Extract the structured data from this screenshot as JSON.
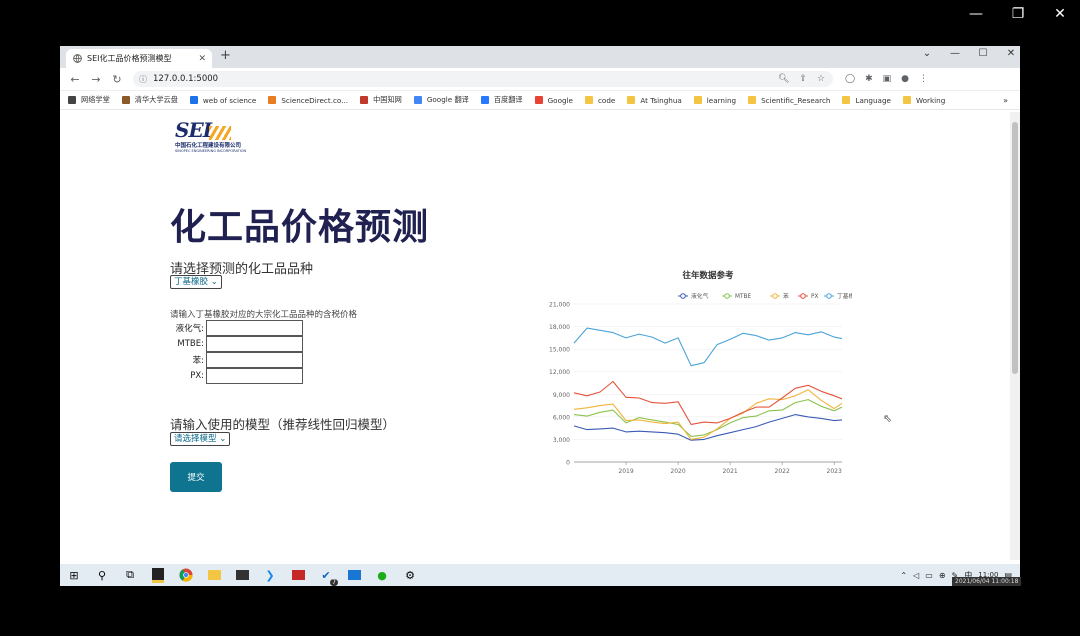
{
  "browser": {
    "tab_title": "SEI化工品价格预测模型",
    "new_tab": "+",
    "url": "127.0.0.1:5000",
    "bookmarks": [
      {
        "label": "网络学堂",
        "color": "#444"
      },
      {
        "label": "清华大学云盘",
        "color": "#8a5a2b"
      },
      {
        "label": "web of science",
        "color": "#1a73e8"
      },
      {
        "label": "ScienceDirect.co...",
        "color": "#e67e22"
      },
      {
        "label": "中国知网",
        "color": "#c0392b"
      },
      {
        "label": "Google 翻译",
        "color": "#4285f4"
      },
      {
        "label": "百度翻译",
        "color": "#2979ff"
      },
      {
        "label": "Google",
        "color": "#ea4335"
      },
      {
        "label": "code",
        "folder": true
      },
      {
        "label": "At Tsinghua",
        "folder": true
      },
      {
        "label": "learning",
        "folder": true
      },
      {
        "label": "Scientific_Research",
        "folder": true
      },
      {
        "label": "Language",
        "folder": true
      },
      {
        "label": "Working",
        "folder": true
      }
    ],
    "bookmarks_more": "»"
  },
  "page": {
    "logo_mark": "SEI",
    "logo_cn": "中国石化工程建设有限公司",
    "logo_en": "SINOPEC ENGINEERING INCORPORATION",
    "title": "化工品价格预测",
    "select_product_label": "请选择预测的化工品品种",
    "product_selected": "丁基橡胶",
    "input_hint": "请输入丁基橡胶对应的大宗化工品品种的含税价格",
    "fields": [
      {
        "label": "液化气:",
        "value": ""
      },
      {
        "label": "MTBE:",
        "value": ""
      },
      {
        "label": "苯:",
        "value": ""
      },
      {
        "label": "PX:",
        "value": ""
      }
    ],
    "model_label": "请输入使用的模型（推荐线性回归模型）",
    "model_selected": "请选择模型",
    "submit_label": "提交"
  },
  "chart_data": {
    "type": "line",
    "title": "往年数据参考",
    "ylim": [
      0,
      21000
    ],
    "yticks": [
      "0",
      "3,000",
      "6,000",
      "9,000",
      "12,000",
      "15,000",
      "18,000",
      "21,000"
    ],
    "xticks": [
      "2019",
      "2020",
      "2021",
      "2022",
      "2023"
    ],
    "x": [
      2018.0,
      2018.25,
      2018.5,
      2018.75,
      2019.0,
      2019.25,
      2019.5,
      2019.75,
      2020.0,
      2020.25,
      2020.5,
      2020.75,
      2021.0,
      2021.25,
      2021.5,
      2021.75,
      2022.0,
      2022.25,
      2022.5,
      2022.75,
      2023.0,
      2023.15
    ],
    "legend_position": "top-right",
    "series": [
      {
        "name": "液化气",
        "color": "#3b5bb5",
        "values": [
          4800,
          4300,
          4400,
          4500,
          4000,
          4100,
          4000,
          3900,
          3700,
          2900,
          3000,
          3500,
          3900,
          4300,
          4700,
          5300,
          5800,
          6300,
          6000,
          5800,
          5500,
          5600
        ]
      },
      {
        "name": "MTBE",
        "color": "#8bc34a",
        "values": [
          6300,
          6100,
          6600,
          6900,
          5200,
          5900,
          5600,
          5300,
          5000,
          3400,
          3600,
          4300,
          5200,
          5900,
          6100,
          6800,
          6900,
          7900,
          8300,
          7400,
          6800,
          7300
        ]
      },
      {
        "name": "苯",
        "color": "#f0b43c",
        "values": [
          7000,
          7200,
          7500,
          7700,
          5500,
          5600,
          5300,
          5100,
          5300,
          3000,
          3300,
          4400,
          5800,
          6500,
          7800,
          8400,
          8300,
          8800,
          9600,
          8200,
          7100,
          7800
        ]
      },
      {
        "name": "PX",
        "color": "#e5533d",
        "values": [
          9200,
          8800,
          9300,
          10700,
          8600,
          8500,
          7900,
          7800,
          8000,
          5000,
          5300,
          5200,
          5800,
          6600,
          7300,
          7300,
          8500,
          9800,
          10200,
          9400,
          8800,
          8400
        ]
      },
      {
        "name": "丁基橡胶",
        "color": "#4aa4d9",
        "values": [
          15800,
          17800,
          17500,
          17200,
          16500,
          17000,
          16600,
          15800,
          16500,
          12800,
          13200,
          15600,
          16300,
          17100,
          16800,
          16200,
          16500,
          17200,
          16900,
          17300,
          16600,
          16400
        ]
      }
    ]
  },
  "taskbar": {
    "time": "11:00",
    "date": "2021/06/04 11:00:18",
    "ime": "中",
    "badge": "7"
  }
}
